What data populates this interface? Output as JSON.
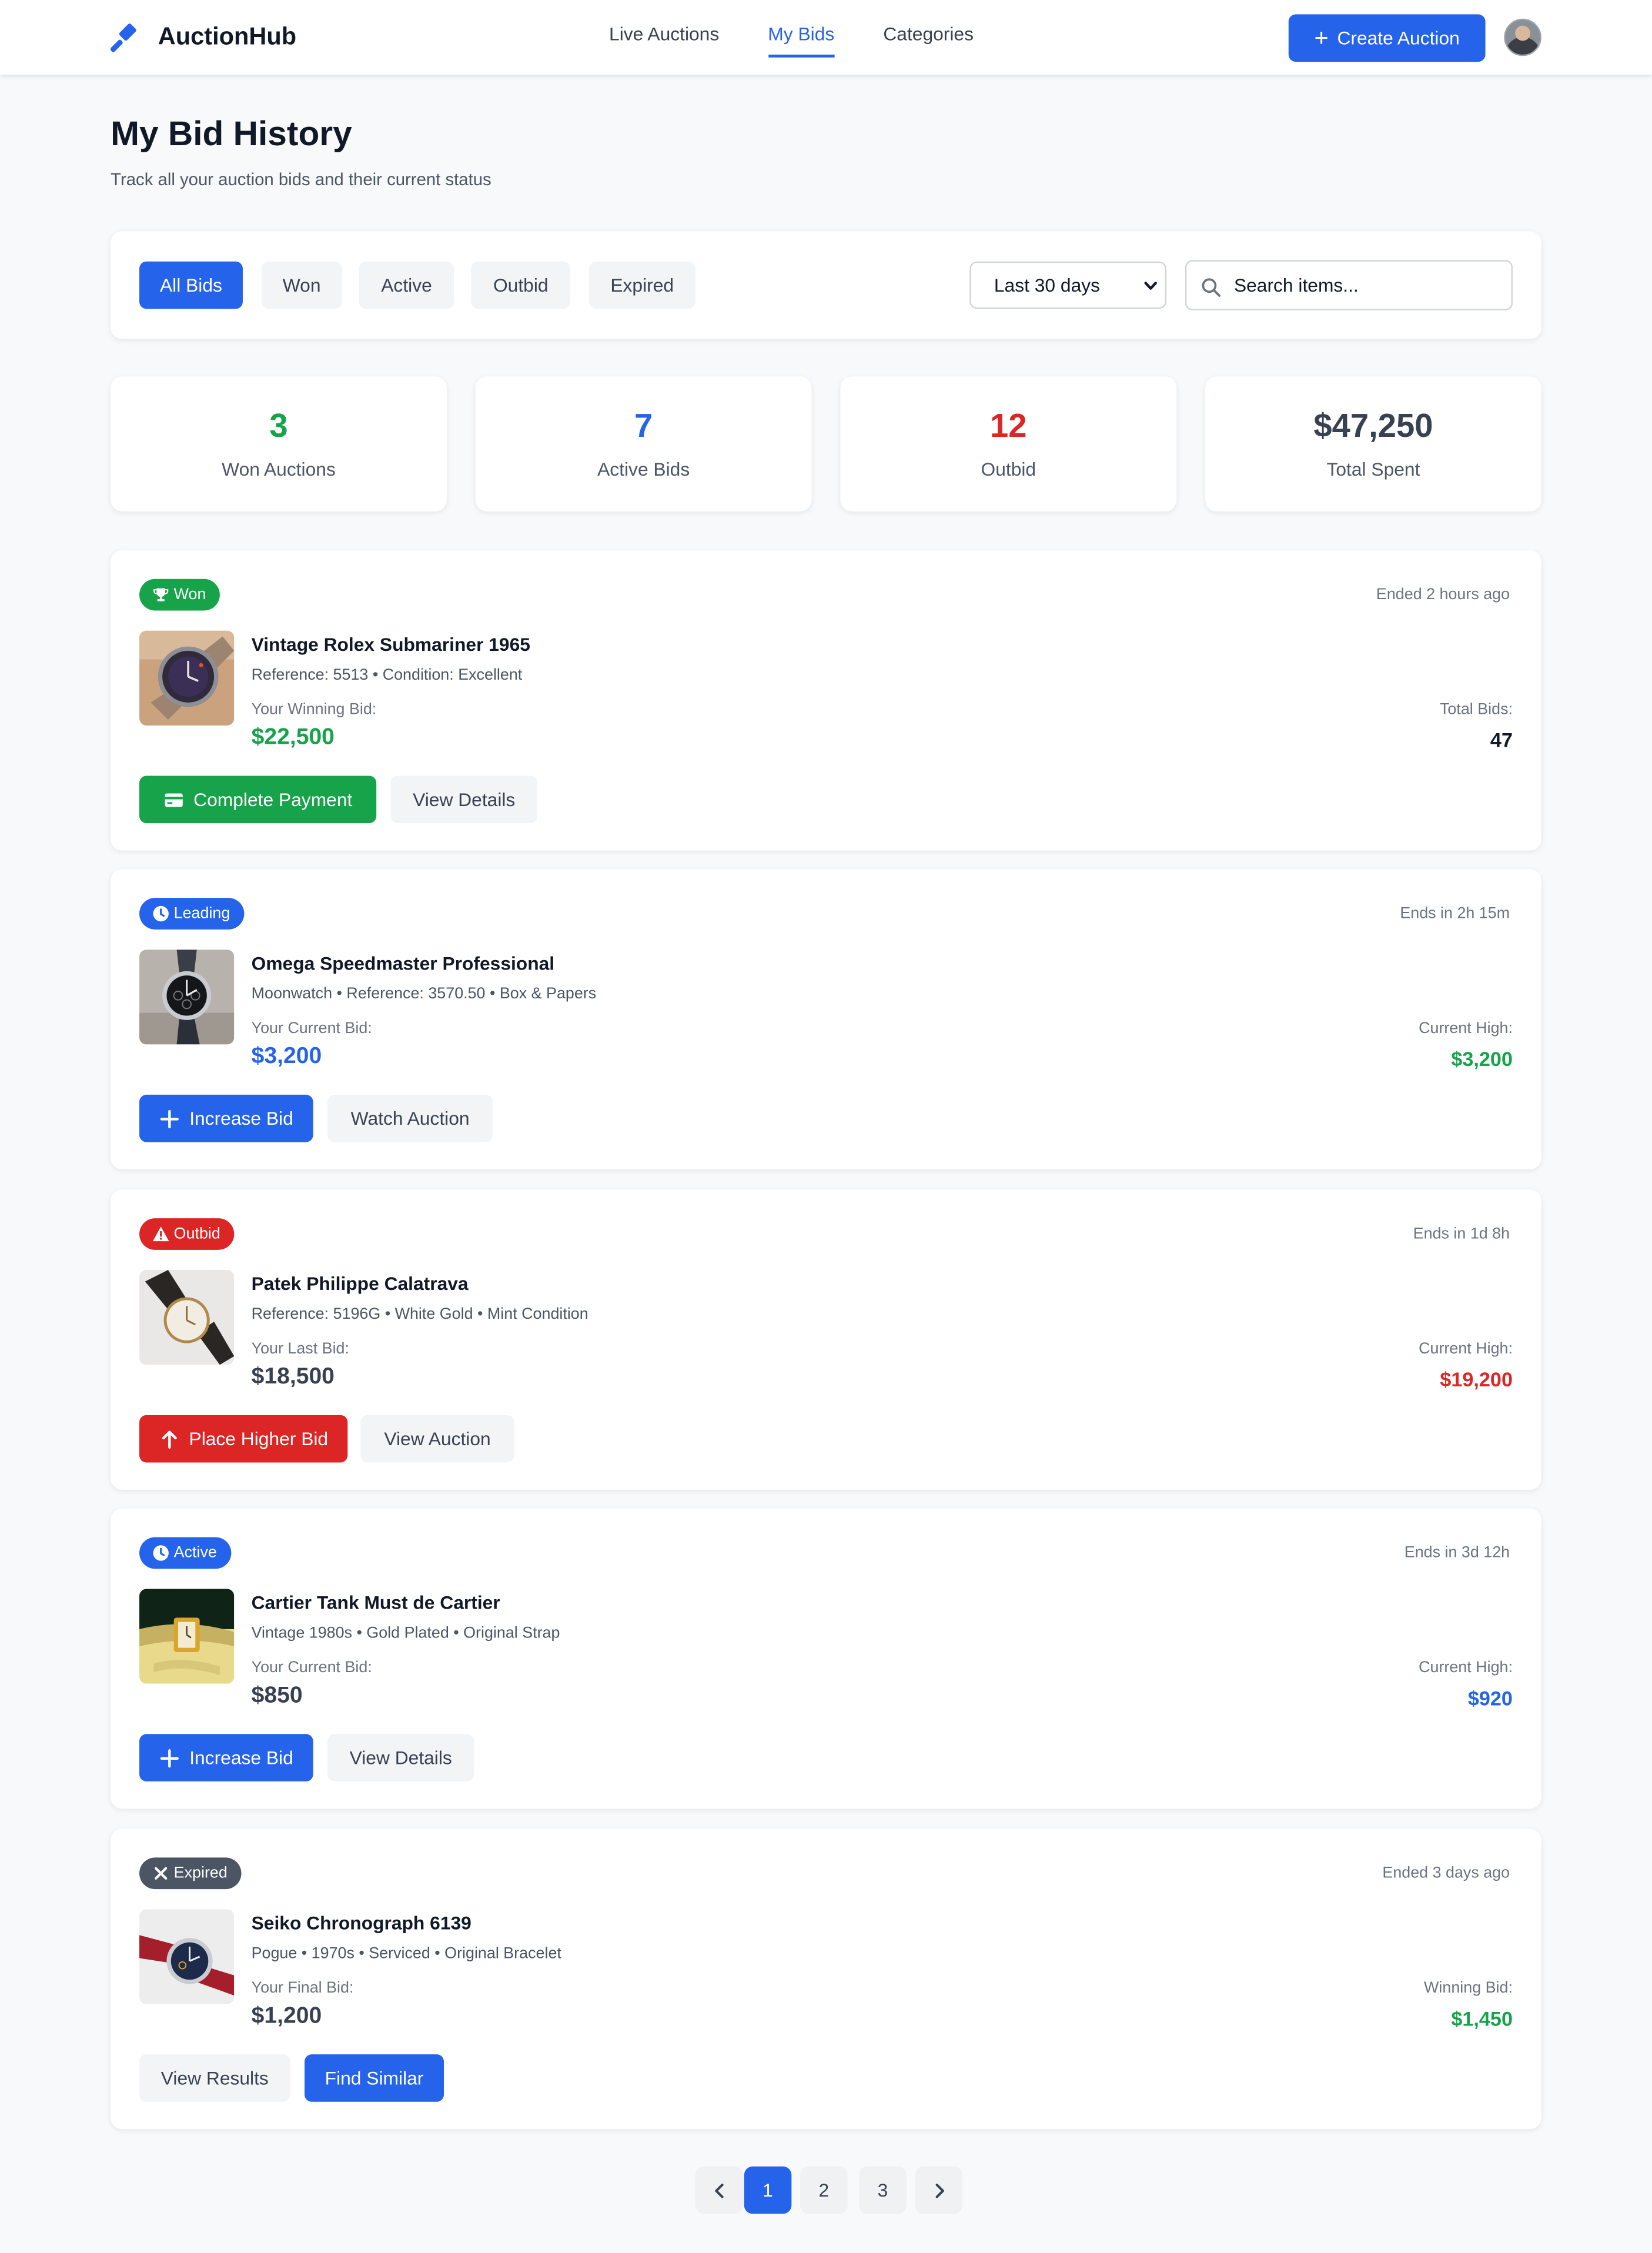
{
  "header": {
    "brand": "AuctionHub",
    "nav": [
      {
        "label": "Live Auctions",
        "active": false
      },
      {
        "label": "My Bids",
        "active": true
      },
      {
        "label": "Categories",
        "active": false
      }
    ],
    "create_label": "Create Auction",
    "accent": "#2563eb"
  },
  "page": {
    "title": "My Bid History",
    "subtitle": "Track all your auction bids and their current status"
  },
  "filters": {
    "chips": [
      {
        "label": "All Bids",
        "active": true
      },
      {
        "label": "Won",
        "active": false
      },
      {
        "label": "Active",
        "active": false
      },
      {
        "label": "Outbid",
        "active": false
      },
      {
        "label": "Expired",
        "active": false
      }
    ],
    "range": {
      "selected": "Last 30 days"
    },
    "search": {
      "placeholder": "Search items..."
    }
  },
  "stats": [
    {
      "value": "3",
      "label": "Won Auctions",
      "color": "#16a34a"
    },
    {
      "value": "7",
      "label": "Active Bids",
      "color": "#2563eb"
    },
    {
      "value": "12",
      "label": "Outbid",
      "color": "#dc2626"
    },
    {
      "value": "$47,250",
      "label": "Total Spent",
      "color": "#374151"
    }
  ],
  "bids": [
    {
      "status": "Won",
      "status_icon": "trophy-icon",
      "status_color": "#16a34a",
      "time_note": "Ended 2 hours ago",
      "title": "Vintage Rolex Submariner 1965",
      "meta": "Reference: 5513 • Condition: Excellent",
      "bid_label": "Your Winning Bid:",
      "bid_amount": "$22,500",
      "bid_color": "#16a34a",
      "right_label": "Total Bids:",
      "right_value": "47",
      "right_color": "#111827",
      "actions": [
        {
          "label": "Complete Payment",
          "style": "green",
          "icon": "credit-card-icon"
        },
        {
          "label": "View Details",
          "style": "gray",
          "icon": ""
        }
      ]
    },
    {
      "status": "Leading",
      "status_icon": "clock-icon",
      "status_color": "#2563eb",
      "time_note": "Ends in 2h 15m",
      "title": "Omega Speedmaster Professional",
      "meta": "Moonwatch • Reference: 3570.50 • Box & Papers",
      "bid_label": "Your Current Bid:",
      "bid_amount": "$3,200",
      "bid_color": "#2563eb",
      "right_label": "Current High:",
      "right_value": "$3,200",
      "right_color": "#16a34a",
      "actions": [
        {
          "label": "Increase Bid",
          "style": "blue",
          "icon": "plus-icon"
        },
        {
          "label": "Watch Auction",
          "style": "gray",
          "icon": ""
        }
      ]
    },
    {
      "status": "Outbid",
      "status_icon": "warning-icon",
      "status_color": "#dc2626",
      "time_note": "Ends in 1d 8h",
      "title": "Patek Philippe Calatrava",
      "meta": "Reference: 5196G • White Gold • Mint Condition",
      "bid_label": "Your Last Bid:",
      "bid_amount": "$18,500",
      "bid_color": "#374151",
      "right_label": "Current High:",
      "right_value": "$19,200",
      "right_color": "#dc2626",
      "actions": [
        {
          "label": "Place Higher Bid",
          "style": "red",
          "icon": "arrow-up-icon"
        },
        {
          "label": "View Auction",
          "style": "gray",
          "icon": ""
        }
      ]
    },
    {
      "status": "Active",
      "status_icon": "clock-icon",
      "status_color": "#2563eb",
      "time_note": "Ends in 3d 12h",
      "title": "Cartier Tank Must de Cartier",
      "meta": "Vintage 1980s • Gold Plated • Original Strap",
      "bid_label": "Your Current Bid:",
      "bid_amount": "$850",
      "bid_color": "#374151",
      "right_label": "Current High:",
      "right_value": "$920",
      "right_color": "#2563eb",
      "actions": [
        {
          "label": "Increase Bid",
          "style": "blue",
          "icon": "plus-icon"
        },
        {
          "label": "View Details",
          "style": "gray",
          "icon": ""
        }
      ]
    },
    {
      "status": "Expired",
      "status_icon": "close-icon",
      "status_color": "#4b5563",
      "time_note": "Ended 3 days ago",
      "title": "Seiko Chronograph 6139",
      "meta": "Pogue • 1970s • Serviced • Original Bracelet",
      "bid_label": "Your Final Bid:",
      "bid_amount": "$1,200",
      "bid_color": "#374151",
      "right_label": "Winning Bid:",
      "right_value": "$1,450",
      "right_color": "#16a34a",
      "actions": [
        {
          "label": "View Results",
          "style": "gray",
          "icon": ""
        },
        {
          "label": "Find Similar",
          "style": "blue",
          "icon": ""
        }
      ]
    }
  ],
  "pagination": {
    "pages": [
      "1",
      "2",
      "3"
    ],
    "current": "1"
  }
}
